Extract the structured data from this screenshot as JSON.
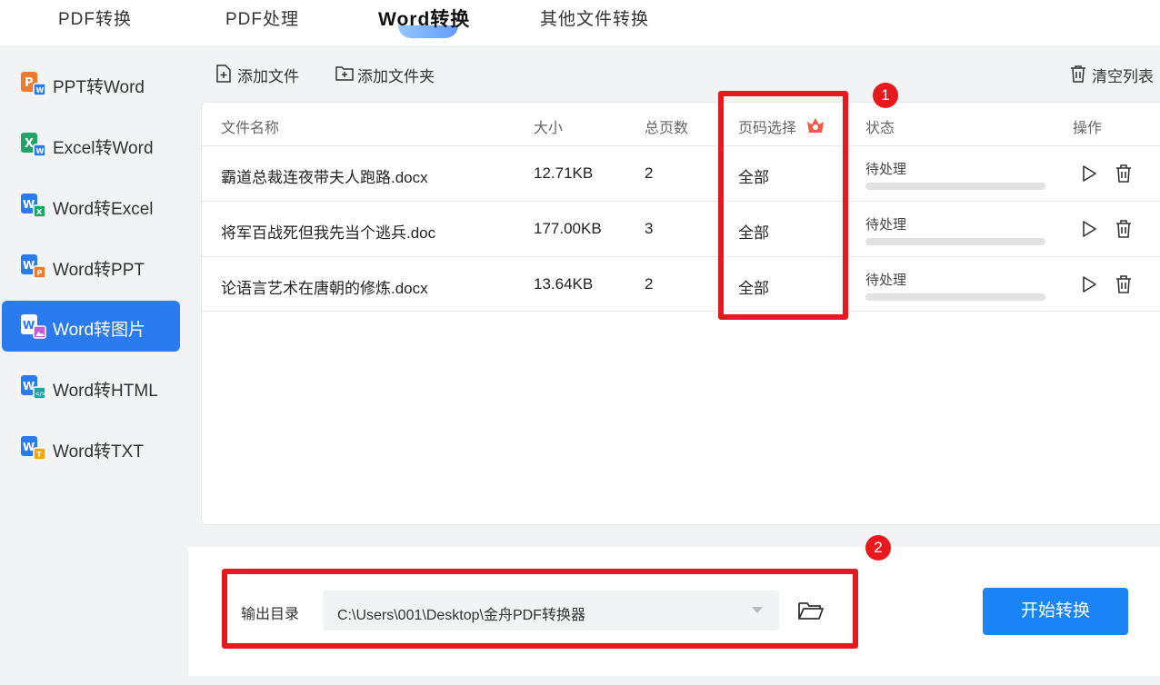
{
  "top_tabs": [
    "PDF转换",
    "PDF处理",
    "Word转换",
    "其他文件转换"
  ],
  "active_tab": "Word转换",
  "sidebar": {
    "items": [
      {
        "label": "PPT转Word",
        "icon": "ppt-to-word-icon",
        "badge_color": "#f07a2b"
      },
      {
        "label": "Excel转Word",
        "icon": "excel-to-word-icon",
        "badge_color": "#21a366"
      },
      {
        "label": "Word转Excel",
        "icon": "word-to-excel-icon",
        "badge_color": "#2b7bf0"
      },
      {
        "label": "Word转PPT",
        "icon": "word-to-ppt-icon",
        "badge_color": "#2b7bf0"
      },
      {
        "label": "Word转图片",
        "icon": "word-to-image-icon",
        "badge_color": "#2b7bf0",
        "active": true
      },
      {
        "label": "Word转HTML",
        "icon": "word-to-html-icon",
        "badge_color": "#2b7bf0"
      },
      {
        "label": "Word转TXT",
        "icon": "word-to-txt-icon",
        "badge_color": "#2b7bf0"
      }
    ]
  },
  "toolbar": {
    "add_file": "添加文件",
    "add_folder": "添加文件夹",
    "clear_list": "清空列表"
  },
  "table": {
    "headers": {
      "name": "文件名称",
      "size": "大小",
      "pages": "总页数",
      "page_select": "页码选择",
      "status": "状态",
      "action": "操作"
    },
    "rows": [
      {
        "name": "霸道总裁连夜带夫人跑路.docx",
        "size": "12.71KB",
        "pages": "2",
        "page_select": "全部",
        "status": "待处理",
        "progress": 0
      },
      {
        "name": "将军百战死但我先当个逃兵.doc",
        "size": "177.00KB",
        "pages": "3",
        "page_select": "全部",
        "status": "待处理",
        "progress": 0
      },
      {
        "name": "论语言艺术在唐朝的修炼.docx",
        "size": "13.64KB",
        "pages": "2",
        "page_select": "全部",
        "status": "待处理",
        "progress": 0
      }
    ]
  },
  "output": {
    "label": "输出目录",
    "path": "C:\\Users\\001\\Desktop\\金舟PDF转换器"
  },
  "start_button": "开始转换",
  "annotations": {
    "badge_1": "1",
    "badge_2": "2"
  },
  "colors": {
    "accent": "#2b7bf0",
    "start_button": "#1a83f5",
    "highlight": "#e8191c",
    "vip": "#f2574a"
  }
}
